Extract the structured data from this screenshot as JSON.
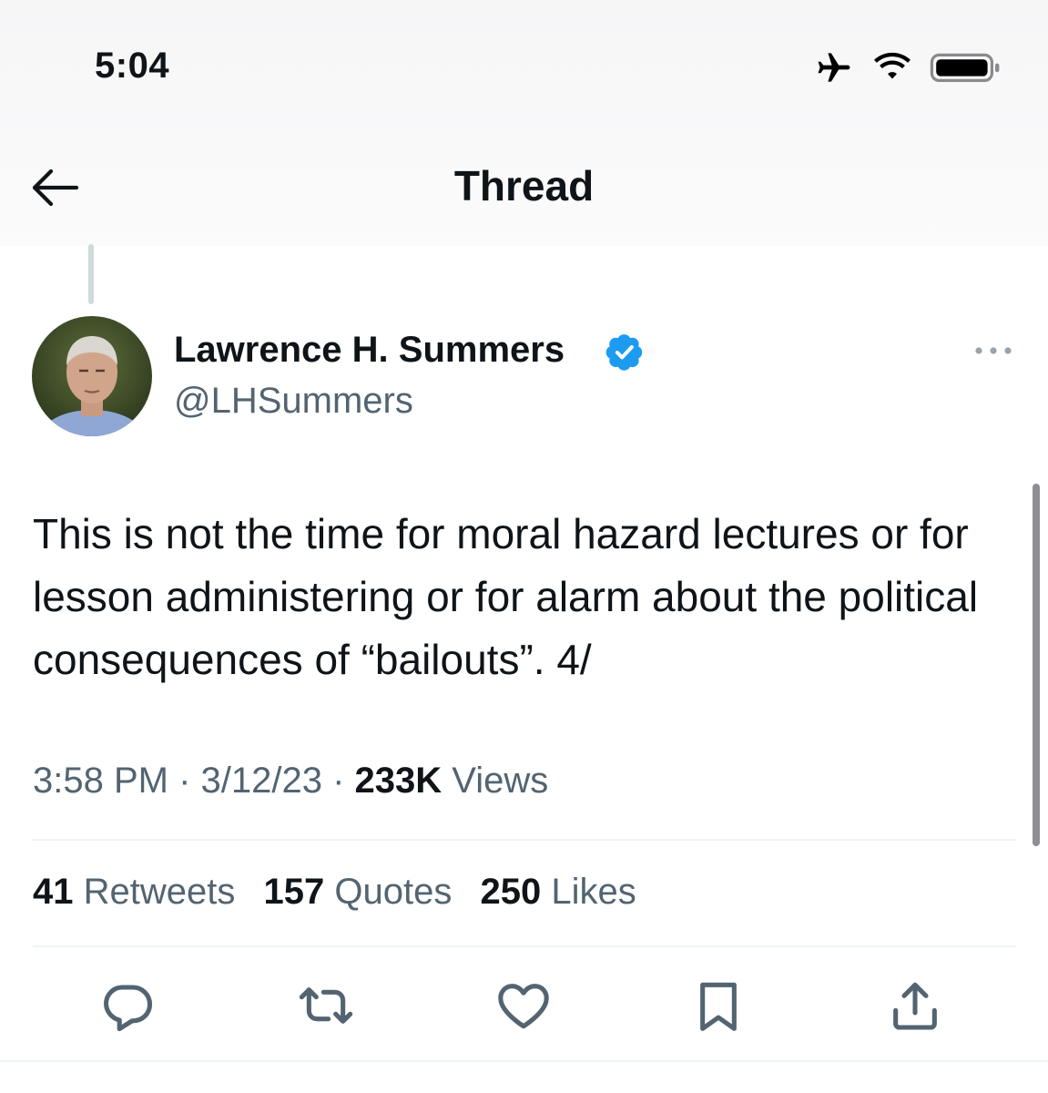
{
  "status_bar": {
    "time": "5:04",
    "icons": [
      "airplane-icon",
      "wifi-icon",
      "battery-icon"
    ]
  },
  "header": {
    "title": "Thread",
    "back_icon": "arrow-left-icon"
  },
  "tweet": {
    "author_name": "Lawrence H. Summers",
    "handle": "@LHSummers",
    "verified_icon": "verified-badge-icon",
    "more_icon": "more-dots-icon",
    "text": "This is not the time for moral hazard lectures or for lesson administering or for alarm about the political consequences of “bailouts”. 4/",
    "time": "3:58 PM",
    "separator": " · ",
    "date": "3/12/23",
    "views_count": "233K",
    "views_label": "Views"
  },
  "stats": {
    "retweets_count": "41",
    "retweets_label": "Retweets",
    "quotes_count": "157",
    "quotes_label": "Quotes",
    "likes_count": "250",
    "likes_label": "Likes"
  },
  "actions": [
    "reply-icon",
    "retweet-icon",
    "like-icon",
    "bookmark-icon",
    "share-icon"
  ],
  "colors": {
    "text": "#0f1419",
    "secondary": "#536471",
    "verified": "#1d9bf0",
    "divider": "#eff3f4",
    "thread_line": "#cfd9de"
  }
}
